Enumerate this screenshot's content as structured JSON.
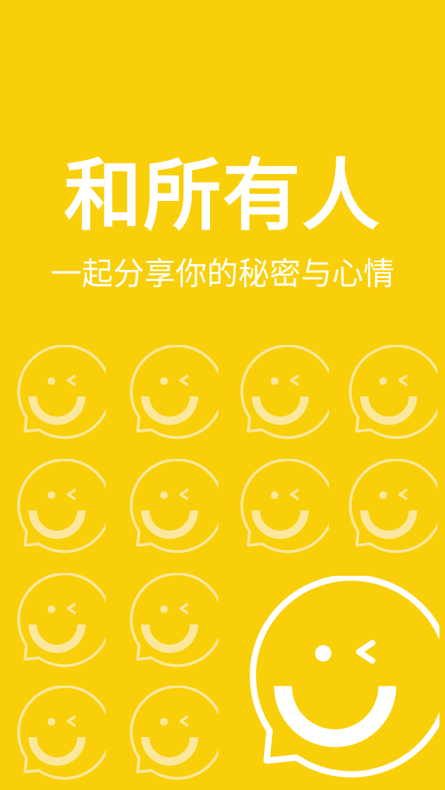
{
  "colors": {
    "background": "#f9cf0a",
    "text": "#ffffff",
    "icon_faded": "#fbe89e",
    "icon_bold": "#ffffff"
  },
  "splash": {
    "headline": "和所有人",
    "subheadline": "一起分享你的秘密与心情"
  },
  "icons": {
    "grid_icon": "winking-smiley-chat-bubble-icon",
    "grid_count": 12,
    "logo_icon": "winking-smiley-chat-bubble-logo"
  }
}
